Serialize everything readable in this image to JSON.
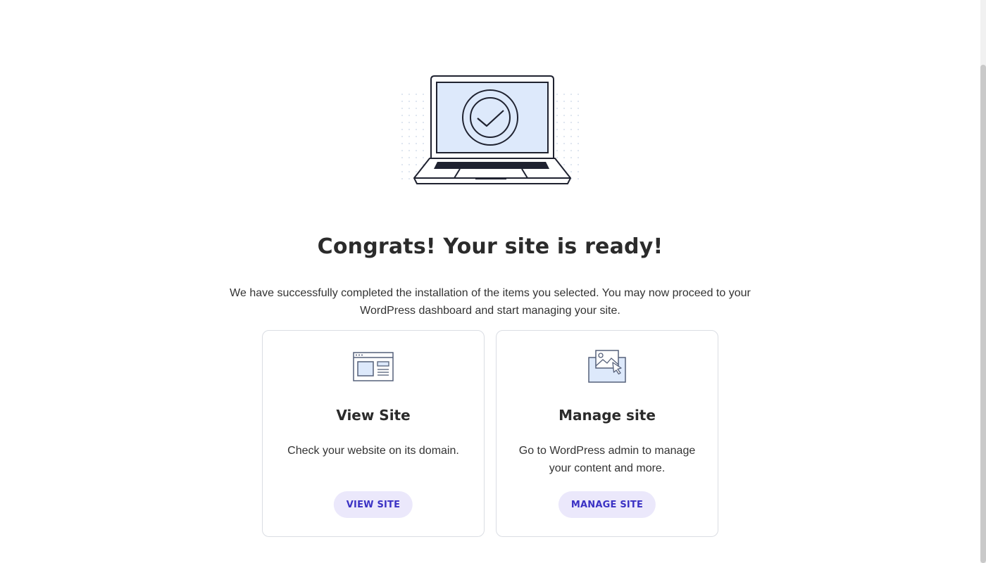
{
  "page": {
    "title": "Congrats! Your site is ready!",
    "intro": "We have successfully completed the installation of the items you selected. You may now proceed to your WordPress dashboard and start managing your site.",
    "hero_icon": "laptop-checkmark-icon"
  },
  "cards": [
    {
      "icon": "browser-window-icon",
      "title": "View Site",
      "description": "Check your website on its domain.",
      "button_label": "VIEW SITE"
    },
    {
      "icon": "image-cursor-icon",
      "title": "Manage site",
      "description": "Go to WordPress admin to manage your content and more.",
      "button_label": "MANAGE SITE"
    }
  ],
  "colors": {
    "accent": "#3b32c4",
    "button_bg": "#ebe8fb",
    "screen_fill": "#dde9fb",
    "heading": "#2b2b2b"
  }
}
